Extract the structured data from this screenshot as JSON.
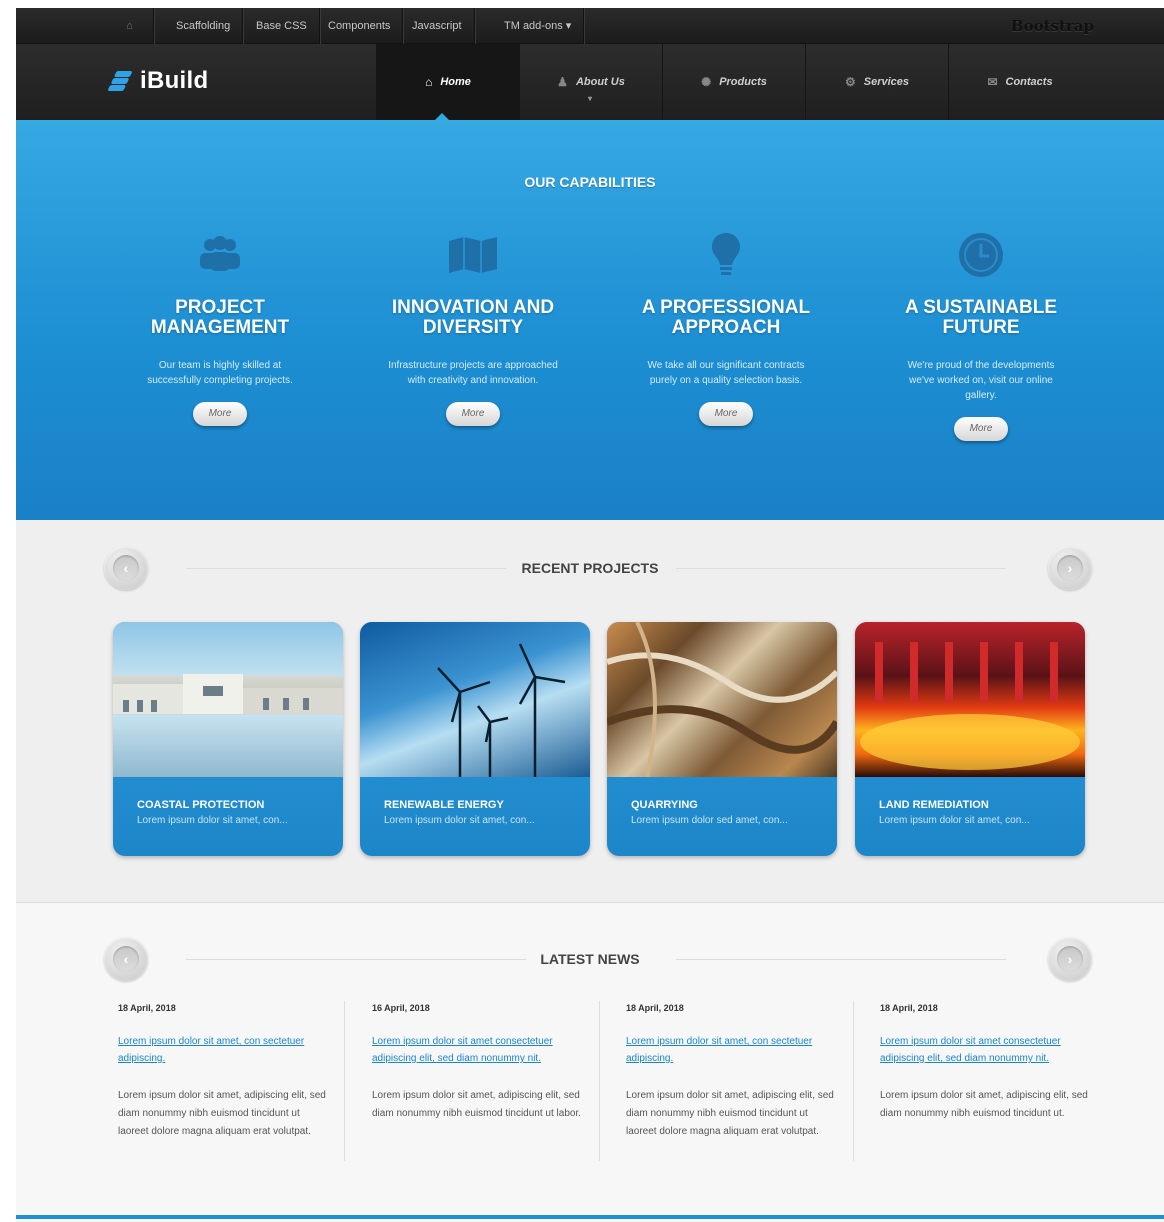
{
  "topbar": {
    "items": [
      "Scaffolding",
      "Base CSS",
      "Components",
      "Javascript",
      "TM add-ons ▾"
    ],
    "brand": "Bootstrap"
  },
  "navbar": {
    "logo": "iBuild",
    "items": [
      {
        "label": "Home",
        "icon": "home-icon",
        "active": true
      },
      {
        "label": "About Us",
        "icon": "user-icon"
      },
      {
        "label": "Products",
        "icon": "gear-icon"
      },
      {
        "label": "Services",
        "icon": "settings-icon"
      },
      {
        "label": "Contacts",
        "icon": "bell-icon"
      }
    ]
  },
  "capabilities": {
    "title": "OUR CAPABILITIES",
    "cards": [
      {
        "icon": "team-icon",
        "heading": "PROJECT MANAGEMENT",
        "text": "Our team is highly skilled at successfully completing projects.",
        "button": "More"
      },
      {
        "icon": "map-icon",
        "heading": "INNOVATION AND DIVERSITY",
        "text": "Infrastructure projects are approached with creativity and innovation.",
        "button": "More"
      },
      {
        "icon": "lightbulb-icon",
        "heading": "A PROFESSIONAL APPROACH",
        "text": "We take all our significant contracts purely on a quality selection basis.",
        "button": "More"
      },
      {
        "icon": "clock-icon",
        "heading": "A SUSTAINABLE FUTURE",
        "text": "We're proud of the developments we've worked on, visit our online gallery.",
        "button": "More"
      }
    ]
  },
  "projects": {
    "title": "RECENT PROJECTS",
    "items": [
      {
        "title": "COASTAL PROTECTION",
        "desc": "Lorem ipsum dolor sit amet, con..."
      },
      {
        "title": "RENEWABLE ENERGY",
        "desc": "Lorem ipsum dolor sit amet, con..."
      },
      {
        "title": "QUARRYING",
        "desc": "Lorem ipsum dolor sed amet, con..."
      },
      {
        "title": "LAND REMEDIATION",
        "desc": "Lorem ipsum dolor sit amet, con..."
      }
    ]
  },
  "news": {
    "title": "LATEST NEWS",
    "items": [
      {
        "date": "18 April, 2018",
        "link": "Lorem ipsum dolor sit amet, con sectetuer adipiscing.",
        "text": "Lorem ipsum dolor sit amet, adipiscing elit, sed diam nonummy nibh euismod tincidunt ut laoreet dolore magna aliquam erat volutpat."
      },
      {
        "date": "16 April, 2018",
        "link": "Lorem ipsum dolor sit amet consectetuer adipiscing elit, sed diam nonummy nit.",
        "text": "Lorem ipsum dolor sit amet, adipiscing elit, sed diam nonummy nibh euismod tincidunt ut labor."
      },
      {
        "date": "18 April, 2018",
        "link": "Lorem ipsum dolor sit amet, con sectetuer adipiscing.",
        "text": "Lorem ipsum dolor sit amet, adipiscing elit, sed diam nonummy nibh euismod tincidunt ut laoreet dolore magna aliquam erat volutpat."
      },
      {
        "date": "18 April, 2018",
        "link": "Lorem ipsum dolor sit amet consectetuer adipiscing elit, sed diam nonummy nit.",
        "text": "Lorem ipsum dolor sit amet, adipiscing elit, sed diam nonummy nibh euismod tincidunt ut."
      }
    ]
  },
  "colors": {
    "accent": "#1d8fd3",
    "dark": "#1f1f1f"
  }
}
